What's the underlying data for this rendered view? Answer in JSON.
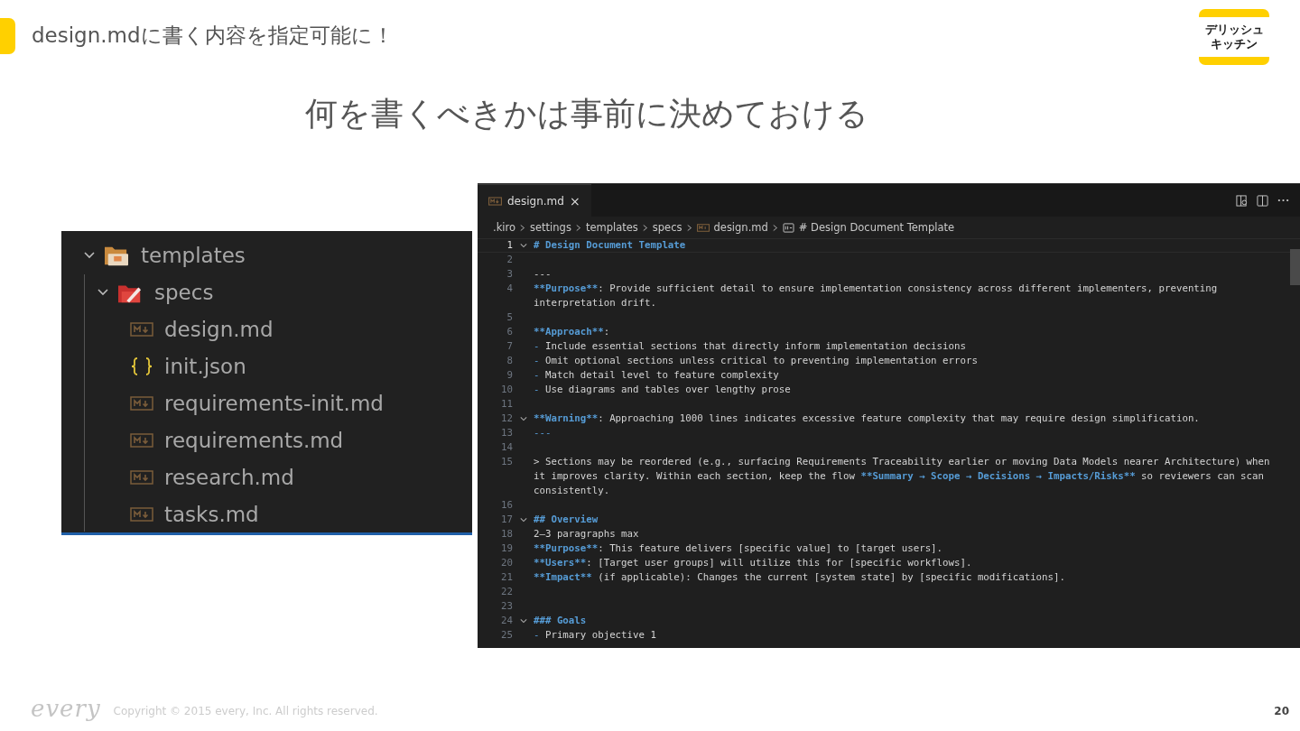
{
  "slide": {
    "heading": "design.mdに書く内容を指定可能に！",
    "logo_lines": [
      "デリッシュ",
      "キッチン"
    ],
    "subtitle": "何を書くべきかは事前に決めておける",
    "footer_logo": "every",
    "copyright": "Copyright © 2015 every, Inc. All rights reserved.",
    "page_number": "20"
  },
  "explorer": {
    "items": [
      {
        "name": "templates",
        "kind": "folder",
        "expanded": true,
        "children": [
          {
            "name": "specs",
            "kind": "specs-folder",
            "expanded": true,
            "children": [
              {
                "name": "design.md",
                "kind": "markdown"
              },
              {
                "name": "init.json",
                "kind": "json"
              },
              {
                "name": "requirements-init.md",
                "kind": "markdown"
              },
              {
                "name": "requirements.md",
                "kind": "markdown"
              },
              {
                "name": "research.md",
                "kind": "markdown"
              },
              {
                "name": "tasks.md",
                "kind": "markdown"
              }
            ]
          }
        ]
      }
    ]
  },
  "editor": {
    "tabs": [
      {
        "label": "design.md",
        "close": "×",
        "selected": true
      }
    ],
    "breadcrumb": [
      {
        "label": ".kiro",
        "kind": "folder"
      },
      {
        "label": "settings",
        "kind": "folder"
      },
      {
        "label": "templates",
        "kind": "folder"
      },
      {
        "label": "specs",
        "kind": "folder"
      },
      {
        "label": "design.md",
        "kind": "markdown"
      },
      {
        "label": "# Design Document Template",
        "kind": "symbol"
      }
    ],
    "lines": [
      {
        "number": "1",
        "current": true,
        "foldable": true,
        "rows": [
          [
            {
              "kind": "strong",
              "text": "# Design Document Template"
            }
          ]
        ]
      },
      {
        "number": "2",
        "current": false,
        "foldable": false
      },
      {
        "number": "3",
        "current": false,
        "foldable": false,
        "rows": [
          [
            {
              "kind": "text",
              "text": "---"
            }
          ]
        ]
      },
      {
        "number": "4",
        "current": false,
        "foldable": false,
        "rows": [
          [
            {
              "kind": "strong",
              "text": "**Purpose**"
            },
            {
              "kind": "text",
              "text": ": Provide sufficient detail to ensure implementation consistency across different implementers, preventing"
            }
          ],
          [
            {
              "kind": "text",
              "text": "interpretation drift."
            }
          ]
        ]
      },
      {
        "number": "5",
        "current": false,
        "foldable": false
      },
      {
        "number": "6",
        "current": false,
        "foldable": false,
        "rows": [
          [
            {
              "kind": "strong",
              "text": "**Approach**"
            },
            {
              "kind": "text",
              "text": ":"
            }
          ]
        ]
      },
      {
        "number": "7",
        "current": false,
        "foldable": false,
        "rows": [
          [
            {
              "kind": "bullet",
              "text": "-"
            },
            {
              "kind": "text",
              "text": " Include essential sections that directly inform implementation decisions"
            }
          ]
        ]
      },
      {
        "number": "8",
        "current": false,
        "foldable": false,
        "rows": [
          [
            {
              "kind": "bullet",
              "text": "-"
            },
            {
              "kind": "text",
              "text": " Omit optional sections unless critical to preventing implementation errors"
            }
          ]
        ]
      },
      {
        "number": "9",
        "current": false,
        "foldable": false,
        "rows": [
          [
            {
              "kind": "bullet",
              "text": "-"
            },
            {
              "kind": "text",
              "text": " Match detail level to feature complexity"
            }
          ]
        ]
      },
      {
        "number": "10",
        "current": false,
        "foldable": false,
        "rows": [
          [
            {
              "kind": "bullet",
              "text": "-"
            },
            {
              "kind": "text",
              "text": " Use diagrams and tables over lengthy prose"
            }
          ]
        ]
      },
      {
        "number": "11",
        "current": false,
        "foldable": false
      },
      {
        "number": "12",
        "current": false,
        "foldable": true,
        "rows": [
          [
            {
              "kind": "strong",
              "text": "**Warning**"
            },
            {
              "kind": "text",
              "text": ": Approaching 1000 lines indicates excessive feature complexity that may require design simplification."
            }
          ]
        ]
      },
      {
        "number": "13",
        "current": false,
        "foldable": false,
        "rows": [
          [
            {
              "kind": "bullet",
              "text": "---"
            }
          ]
        ]
      },
      {
        "number": "14",
        "current": false,
        "foldable": false
      },
      {
        "number": "15",
        "current": false,
        "foldable": false,
        "rows": [
          [
            {
              "kind": "text",
              "text": "> Sections may be reordered (e.g., surfacing Requirements Traceability earlier or moving Data Models nearer Architecture) when"
            }
          ],
          [
            {
              "kind": "text",
              "text": "it improves clarity. Within each section, keep the flow "
            },
            {
              "kind": "strong",
              "text": "**Summary → Scope → Decisions → Impacts/Risks**"
            },
            {
              "kind": "text",
              "text": " so reviewers can scan"
            }
          ],
          [
            {
              "kind": "text",
              "text": "consistently."
            }
          ]
        ]
      },
      {
        "number": "16",
        "current": false,
        "foldable": false
      },
      {
        "number": "17",
        "current": false,
        "foldable": true,
        "rows": [
          [
            {
              "kind": "strong",
              "text": "## Overview"
            }
          ]
        ]
      },
      {
        "number": "18",
        "current": false,
        "foldable": false,
        "rows": [
          [
            {
              "kind": "text",
              "text": "2–3 paragraphs max"
            }
          ]
        ]
      },
      {
        "number": "19",
        "current": false,
        "foldable": false,
        "rows": [
          [
            {
              "kind": "strong",
              "text": "**Purpose**"
            },
            {
              "kind": "text",
              "text": ": This feature delivers [specific value] to [target users]."
            }
          ]
        ]
      },
      {
        "number": "20",
        "current": false,
        "foldable": false,
        "rows": [
          [
            {
              "kind": "strong",
              "text": "**Users**"
            },
            {
              "kind": "text",
              "text": ": [Target user groups] will utilize this for [specific workflows]."
            }
          ]
        ]
      },
      {
        "number": "21",
        "current": false,
        "foldable": false,
        "rows": [
          [
            {
              "kind": "strong",
              "text": "**Impact**"
            },
            {
              "kind": "text",
              "text": " (if applicable): Changes the current [system state] by [specific modifications]."
            }
          ]
        ]
      },
      {
        "number": "22",
        "current": false,
        "foldable": false
      },
      {
        "number": "23",
        "current": false,
        "foldable": false
      },
      {
        "number": "24",
        "current": false,
        "foldable": true,
        "rows": [
          [
            {
              "kind": "strong",
              "text": "### Goals"
            }
          ]
        ]
      },
      {
        "number": "25",
        "current": false,
        "foldable": false,
        "rows": [
          [
            {
              "kind": "bullet",
              "text": "-"
            },
            {
              "kind": "text",
              "text": " Primary objective 1"
            }
          ]
        ]
      }
    ]
  }
}
